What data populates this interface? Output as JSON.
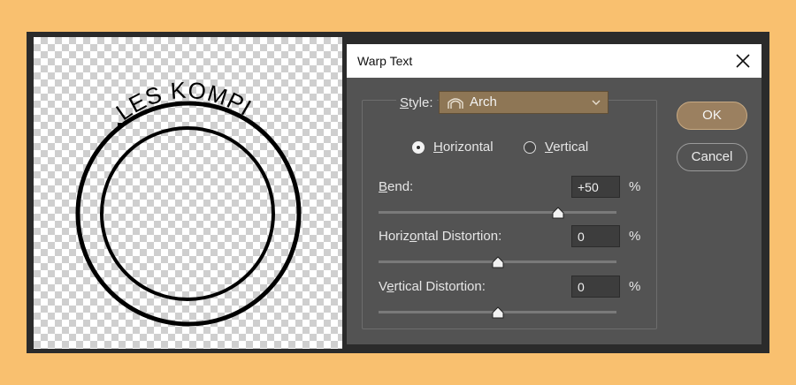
{
  "canvas": {
    "stamp_text": "LES KOMPI"
  },
  "dialog": {
    "title": "Warp Text",
    "style": {
      "label": "Style:",
      "value": "Arch"
    },
    "orientation": {
      "horizontal_label": "Horizontal",
      "vertical_label": "Vertical",
      "selected": "horizontal"
    },
    "bend": {
      "label": "Bend:",
      "value": "+50",
      "unit": "%",
      "level_percent": 50
    },
    "horizontal_distortion": {
      "label": "Horizontal Distortion:",
      "value": "0",
      "unit": "%",
      "level_percent": 0
    },
    "vertical_distortion": {
      "label": "Vertical Distortion:",
      "value": "0",
      "unit": "%",
      "level_percent": 0
    },
    "ok_label": "OK",
    "cancel_label": "Cancel"
  },
  "colors": {
    "background": "#f9c06f",
    "dialog_bg": "#535353",
    "select_bg": "#8e7655",
    "ok_button": "#9b8060"
  },
  "icons": {
    "close": "close-icon",
    "arch": "arch-icon",
    "dropdown": "chevron-down-icon"
  }
}
